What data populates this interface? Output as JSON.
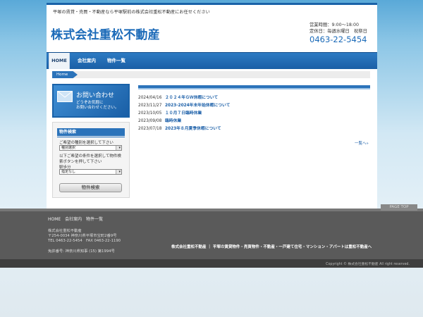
{
  "header": {
    "tagline": "平塚の賃貸・売買・不動産なら平塚駅前の株式会社重松不動産にお任せください",
    "logo": "株式会社重松不動産",
    "hours": "営業時間：9:00～18:00",
    "holiday": "定休日：毎週水曜日　祝祭日",
    "phone": "0463-22-5454"
  },
  "nav": {
    "items": [
      {
        "label": "HOME",
        "active": true
      },
      {
        "label": "会社案内",
        "active": false
      },
      {
        "label": "物件一覧",
        "active": false
      }
    ]
  },
  "breadcrumb": {
    "home": "Home"
  },
  "sidebar": {
    "contact": {
      "title": "お問い合わせ",
      "sub1": "どうぞお気軽に",
      "sub2": "お問い合わせください。"
    },
    "search": {
      "heading": "物件検索",
      "type_label": "ご希望の種別を選択して下さい",
      "type_select": "種別選択",
      "cond_label": "以下ご希望の条件を選択して物件検索ボタンを押して下さい",
      "area_label": "駅歩分",
      "area_select": "指定なし",
      "button": "物件検索"
    }
  },
  "news": {
    "items": [
      {
        "date": "2024/04/16",
        "title": "２０２４年ＧＷ休暇について"
      },
      {
        "date": "2023/11/27",
        "title": "2023-2024年末年始休暇について"
      },
      {
        "date": "2023/10/05",
        "title": "１０月７日臨時休業"
      },
      {
        "date": "2023/09/08",
        "title": "臨時休業"
      },
      {
        "date": "2023/07/18",
        "title": "2023年８月夏季休暇について"
      }
    ],
    "more": "一覧へ»"
  },
  "footer": {
    "links": [
      "HOME",
      "会社案内",
      "物件一覧"
    ],
    "company_name": "株式会社重松不動産",
    "address": "〒254-0034 神奈川県平塚市宝町2番9号",
    "tel_fax": "TEL 0463-22-5454　FAX 0463-22-1190",
    "license": "免許番号: 神奈川県知事 (15) 第1994号",
    "center_text": "株式会社重松不動産 ｜ 平塚の賃貸物件・売買物件・不動産・一戸建て住宅・マンション・アパートは重松不動産へ",
    "page_top": "PAGE TOP",
    "copyright": "Copyright © 株式会社重松不動産 All right reserved."
  },
  "colors": {
    "primary": "#1a62a8",
    "logo": "#1b6ab8",
    "link": "#1b5fa8",
    "footer": "#5a5a5a"
  }
}
